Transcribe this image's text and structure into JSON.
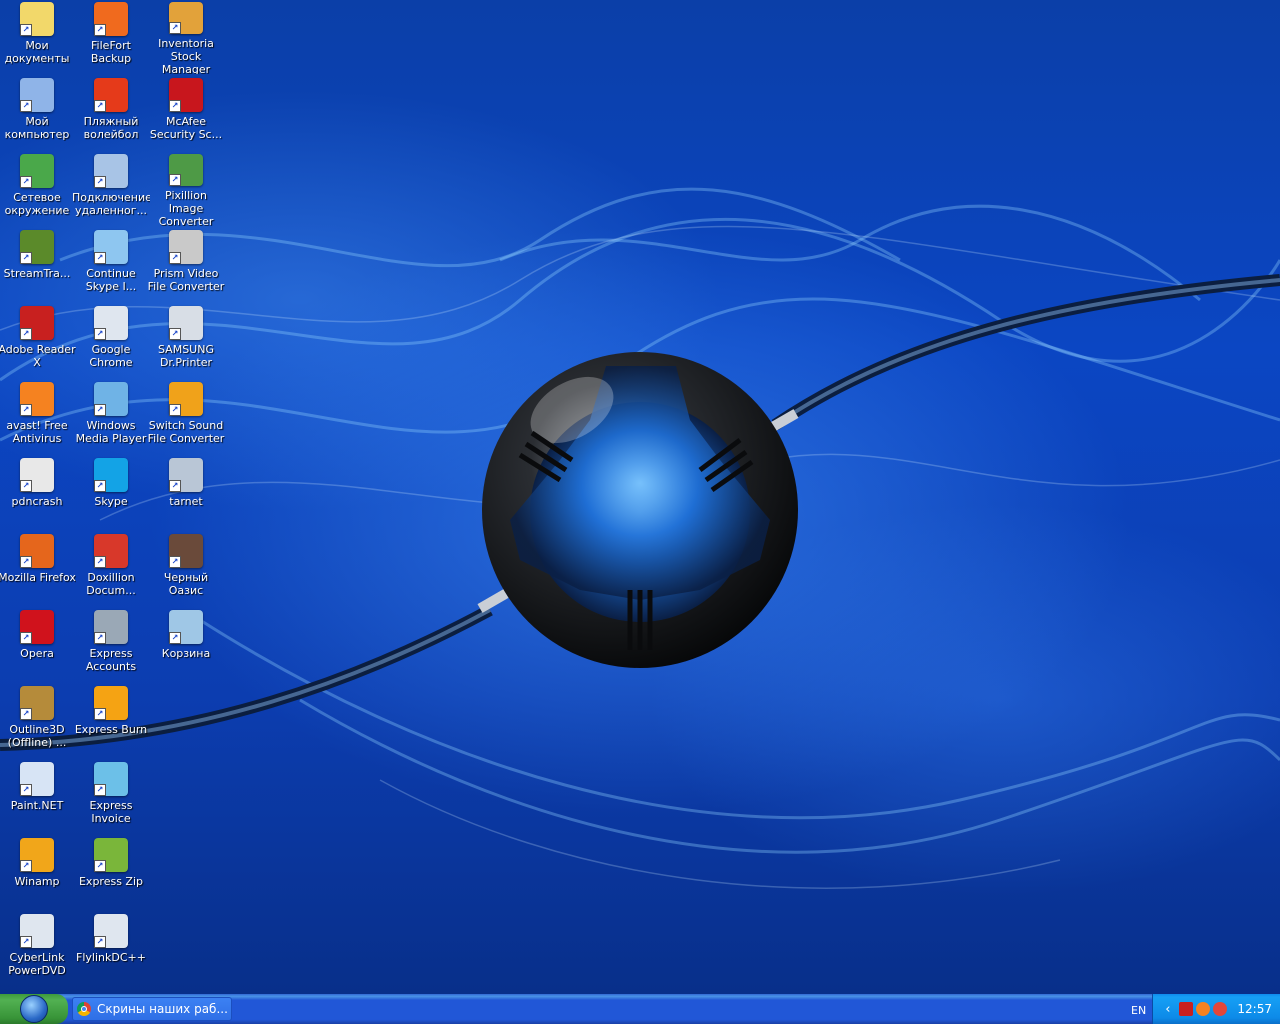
{
  "desktop_icons": [
    {
      "label": "Мои\nдокументы",
      "icon": "my-documents-icon",
      "color": "#f2d86a"
    },
    {
      "label": "Мой\nкомпьютер",
      "icon": "my-computer-icon",
      "color": "#8fb4e8"
    },
    {
      "label": "Сетевое\nокружение",
      "icon": "network-icon",
      "color": "#4aa84a"
    },
    {
      "label": "StreamTra...",
      "icon": "streamtransport-icon",
      "color": "#5b8a2a"
    },
    {
      "label": "Adobe Reader\nX",
      "icon": "adobe-reader-icon",
      "color": "#c8201f"
    },
    {
      "label": "avast! Free\nAntivirus",
      "icon": "avast-icon",
      "color": "#f58220"
    },
    {
      "label": "pdncrash",
      "icon": "text-file-icon",
      "color": "#e8e8e8"
    },
    {
      "label": "Mozilla Firefox",
      "icon": "firefox-icon",
      "color": "#e5661c"
    },
    {
      "label": "Opera",
      "icon": "opera-icon",
      "color": "#d0121c"
    },
    {
      "label": "Outline3D\n(Offline) ...",
      "icon": "outline3d-icon",
      "color": "#b58b3a"
    },
    {
      "label": "Paint.NET",
      "icon": "paint-net-icon",
      "color": "#d7e4f5"
    },
    {
      "label": "Winamp",
      "icon": "winamp-icon",
      "color": "#f1a61a"
    },
    {
      "label": "CyberLink\nPowerDVD",
      "icon": "powerdvd-icon",
      "color": "#dfe6ef"
    },
    {
      "label": "FileFort\nBackup",
      "icon": "filefort-icon",
      "color": "#f06a1e"
    },
    {
      "label": "Пляжный\nволейбол",
      "icon": "beach-volleyball-icon",
      "color": "#e53a1a"
    },
    {
      "label": "Подключение\nудаленног...",
      "icon": "remote-desktop-icon",
      "color": "#a8c4e6"
    },
    {
      "label": "Continue\nSkype I...",
      "icon": "skype-installer-icon",
      "color": "#8ec6f0"
    },
    {
      "label": "Google\nChrome",
      "icon": "app-shortcut-icon",
      "color": "#dfe6ef"
    },
    {
      "label": "Windows\nMedia Player",
      "icon": "windows-media-player-icon",
      "color": "#6fb3e6"
    },
    {
      "label": "Skype",
      "icon": "skype-icon",
      "color": "#13a3e6"
    },
    {
      "label": "Doxillion\nDocum...",
      "icon": "doxillion-icon",
      "color": "#d8382a"
    },
    {
      "label": "Express\nAccounts",
      "icon": "express-accounts-icon",
      "color": "#9aa8b6"
    },
    {
      "label": "Express Burn",
      "icon": "express-burn-icon",
      "color": "#f5a313"
    },
    {
      "label": "Express\nInvoice",
      "icon": "express-invoice-icon",
      "color": "#6cc0e8"
    },
    {
      "label": "Express Zip",
      "icon": "express-zip-icon",
      "color": "#7ab63a"
    },
    {
      "label": "FlylinkDC++",
      "icon": "app-shortcut-icon",
      "color": "#dfe6ef"
    },
    {
      "label": "Inventoria\nStock Manager",
      "icon": "inventoria-icon",
      "color": "#e2a23a"
    },
    {
      "label": "McAfee\nSecurity Sc...",
      "icon": "mcafee-icon",
      "color": "#c8161d"
    },
    {
      "label": "Pixillion Image\nConverter",
      "icon": "pixillion-icon",
      "color": "#4e9a46"
    },
    {
      "label": "Prism Video\nFile Converter",
      "icon": "prism-icon",
      "color": "#c9c9c9"
    },
    {
      "label": "SAMSUNG\nDr.Printer",
      "icon": "samsung-printer-icon",
      "color": "#d8dee6"
    },
    {
      "label": "Switch Sound\nFile Converter",
      "icon": "switch-sound-icon",
      "color": "#f0a21a"
    },
    {
      "label": "tarnet",
      "icon": "tarnet-icon",
      "color": "#b9c6d6"
    },
    {
      "label": "Черный\nОазис",
      "icon": "black-oasis-icon",
      "color": "#6a4a3a"
    },
    {
      "label": "Корзина",
      "icon": "recycle-bin-icon",
      "color": "#9fc7e6"
    }
  ],
  "taskbar": {
    "start_icon": "windows-start-icon",
    "task_label": "Скрины наших раб...",
    "language": "EN",
    "clock": "12:57"
  }
}
